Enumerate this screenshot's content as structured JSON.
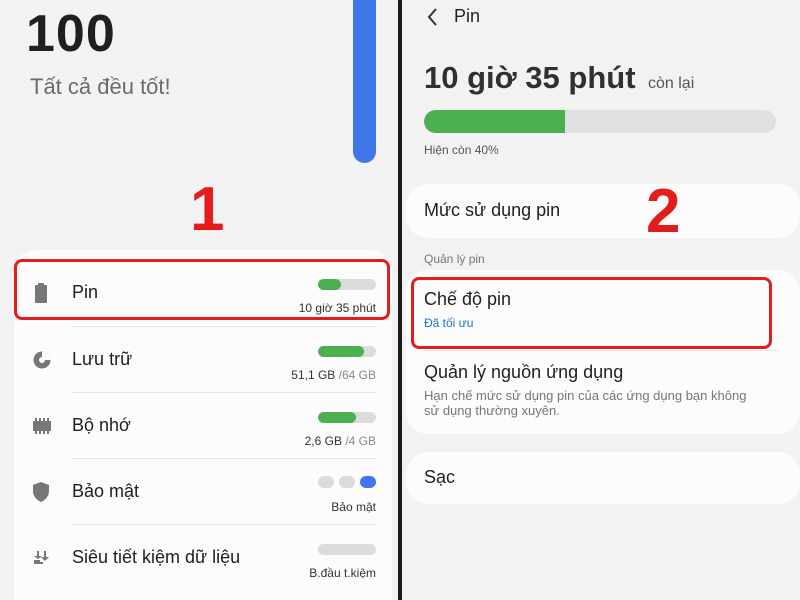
{
  "left_panel": {
    "score": "100",
    "status": "Tất cả đều tốt!",
    "step_marker": "1",
    "items": [
      {
        "label": "Pin",
        "icon": "battery-icon",
        "value": "10 giờ 35 phút",
        "value_muted": "",
        "level": 0.4
      },
      {
        "label": "Lưu trữ",
        "icon": "storage-icon",
        "value": "51,1 GB",
        "value_muted": " /64 GB",
        "level": 0.8
      },
      {
        "label": "Bộ nhớ",
        "icon": "memory-icon",
        "value": "2,6 GB",
        "value_muted": " /4 GB",
        "level": 0.65
      },
      {
        "label": "Bảo mật",
        "icon": "shield-icon",
        "value": "Bảo mật",
        "value_muted": ""
      },
      {
        "label": "Siêu tiết kiệm dữ liệu",
        "icon": "data-saver-icon",
        "value": "B.đầu t.kiệm",
        "value_muted": "",
        "level": 0
      }
    ]
  },
  "right_panel": {
    "title": "Pin",
    "remaining_time": "10 giờ 35 phút",
    "remaining_suffix": "còn lại",
    "battery_level": 0.4,
    "battery_caption": "Hiện còn 40%",
    "step_marker": "2",
    "usage_item": "Mức sử dụng pin",
    "section_label": "Quản lý pin",
    "power_mode": {
      "title": "Chế độ pin",
      "subtitle": "Đã tối ưu"
    },
    "app_power": {
      "title": "Quản lý nguồn ứng dụng",
      "desc": "Hạn chế mức sử dụng pin của các ứng dụng bạn không sử dụng thường xuyên."
    },
    "charging_item": "Sạc"
  },
  "colors": {
    "accent_green": "#4caf50",
    "accent_blue": "#3f76e8",
    "highlight_red": "#e41c1c",
    "link_blue": "#1a73c9"
  }
}
